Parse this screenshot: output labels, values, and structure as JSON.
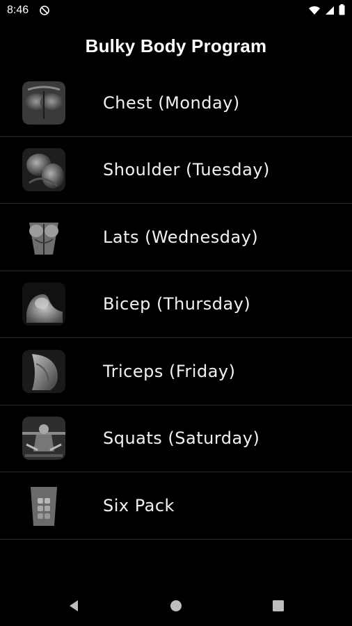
{
  "status_bar": {
    "time": "8:46",
    "icons": [
      "do-not-disturb-icon",
      "wifi-icon",
      "cellular-signal-icon",
      "battery-icon"
    ]
  },
  "app_bar": {
    "title": "Bulky Body Program"
  },
  "workouts": [
    {
      "label": "Chest (Monday)",
      "icon": "chest-thumbnail"
    },
    {
      "label": "Shoulder (Tuesday)",
      "icon": "shoulder-thumbnail"
    },
    {
      "label": "Lats (Wednesday)",
      "icon": "lats-thumbnail"
    },
    {
      "label": "Bicep (Thursday)",
      "icon": "bicep-thumbnail"
    },
    {
      "label": "Triceps (Friday)",
      "icon": "triceps-thumbnail"
    },
    {
      "label": "Squats (Saturday)",
      "icon": "squats-thumbnail"
    },
    {
      "label": "Six Pack",
      "icon": "six-pack-thumbnail"
    }
  ],
  "nav_bar": {
    "icons": [
      "back-icon",
      "home-icon",
      "recents-icon"
    ]
  },
  "colors": {
    "background": "#000000",
    "text": "#f2f2f2",
    "divider": "#2c2c2c",
    "nav_icon": "#bdbdbd"
  }
}
